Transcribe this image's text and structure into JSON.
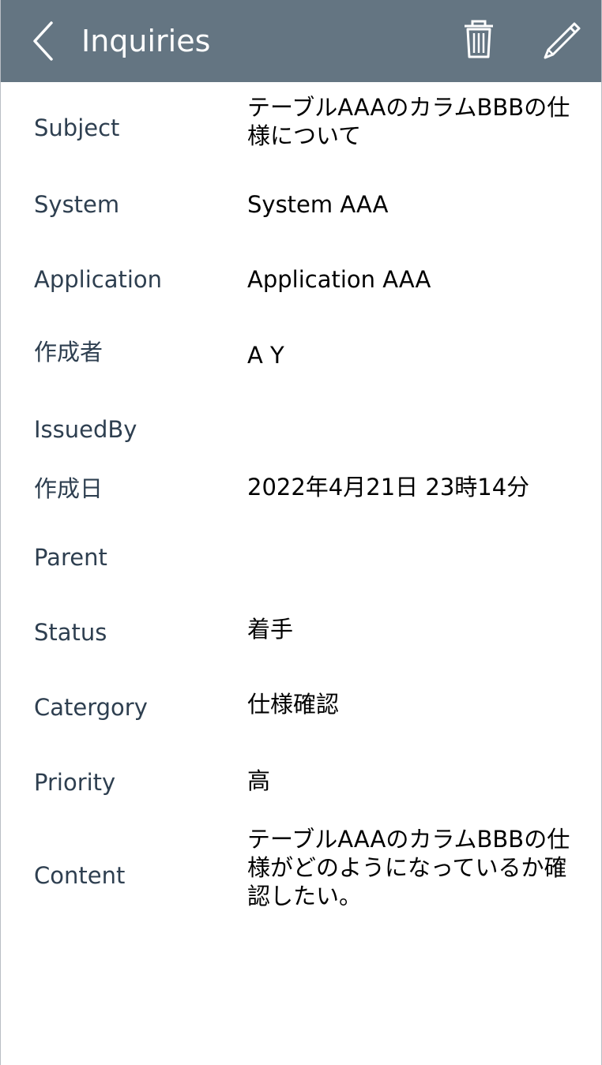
{
  "header": {
    "title": "Inquiries"
  },
  "fields": {
    "subject": {
      "label": "Subject",
      "value": "テーブルAAAのカラムBBBの仕様について"
    },
    "system": {
      "label": "System",
      "value": "System AAA"
    },
    "application": {
      "label": "Application",
      "value": "Application AAA"
    },
    "author": {
      "label": "作成者",
      "value": "A Y"
    },
    "issued_by": {
      "label": "IssuedBy",
      "value": ""
    },
    "created": {
      "label": "作成日",
      "value": "2022年4月21日 23時14分"
    },
    "parent": {
      "label": "Parent",
      "value": ""
    },
    "status": {
      "label": "Status",
      "value": "着手"
    },
    "category": {
      "label": "Catergory",
      "value": "仕様確認"
    },
    "priority": {
      "label": "Priority",
      "value": "高"
    },
    "content": {
      "label": "Content",
      "value": "テーブルAAAのカラムBBBの仕様がどのようになっているか確認したい。"
    }
  },
  "icons": {
    "back": "chevron-left-icon",
    "delete": "trash-icon",
    "edit": "pencil-icon"
  },
  "colors": {
    "header_bg": "#647582",
    "label_text": "#2e3f50",
    "value_text": "#000000"
  }
}
